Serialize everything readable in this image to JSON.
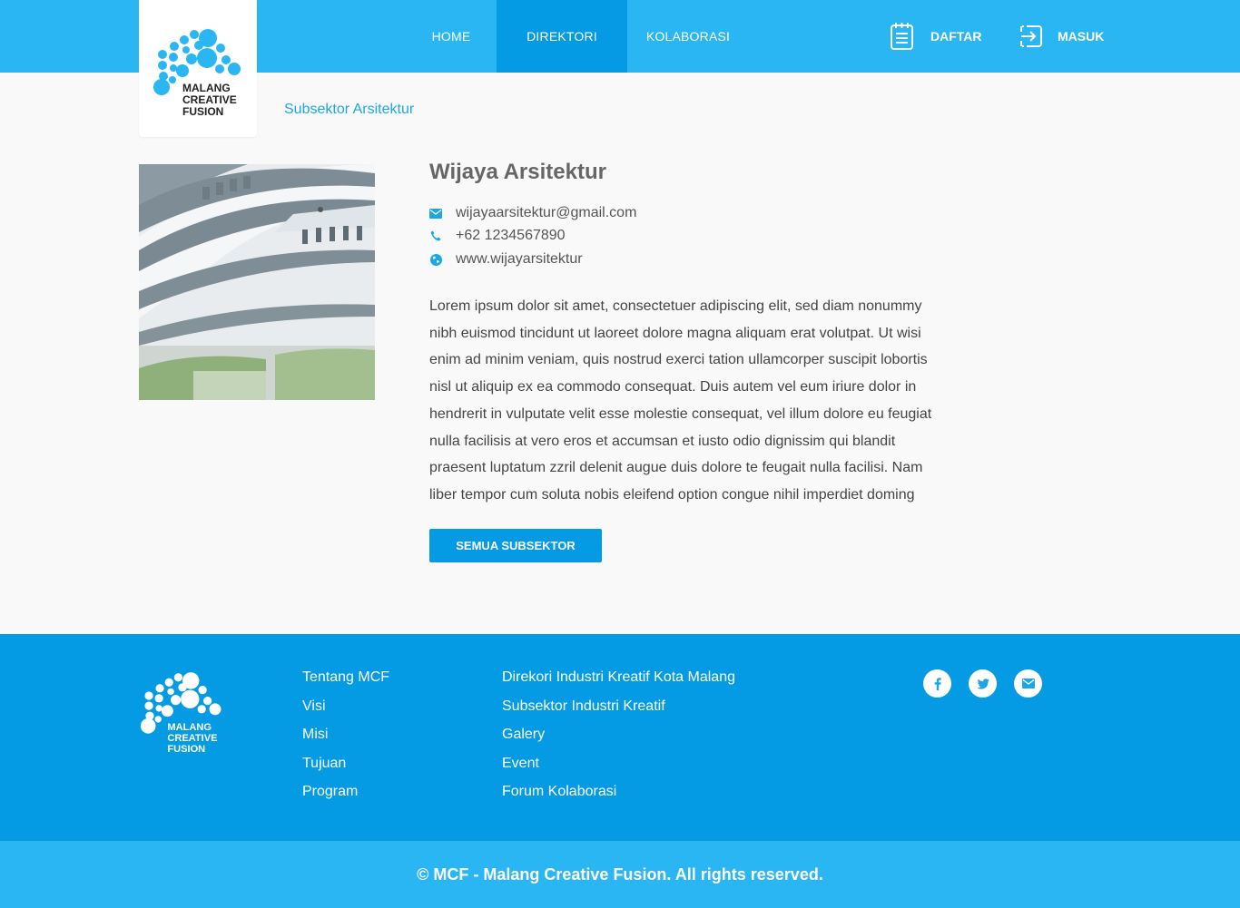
{
  "nav": {
    "home": "HOME",
    "direktori": "DIREKTORI",
    "kolaborasi": "KOLABORASI",
    "daftar": "DAFTAR",
    "masuk": "MASUK",
    "active": "DIREKTORI"
  },
  "logo": {
    "line1": "MALANG",
    "line2": "CREATIVE",
    "line3": "FUSION"
  },
  "breadcrumb": "Subsektor Arsitektur",
  "profile": {
    "name": "Wijaya Arsitektur",
    "email": "wijayaarsitektur@gmail.com",
    "phone": "+62 1234567890",
    "website": "www.wijayarsitektur",
    "description": "Lorem ipsum dolor sit amet, consectetuer adipiscing elit, sed diam nonummy nibh euismod tincidunt ut laoreet dolore magna aliquam erat volutpat. Ut wisi enim ad minim veniam, quis nostrud exerci tation ullamcorper suscipit lobortis nisl ut aliquip ex ea commodo consequat. Duis autem vel eum iriure dolor in hendrerit in vulputate velit esse molestie consequat, vel illum dolore eu feugiat nulla facilisis at vero eros et accumsan et iusto odio dignissim qui blandit praesent luptatum zzril delenit augue duis dolore te feugait nulla facilisi. Nam liber tempor cum soluta nobis eleifend option congue nihil imperdiet doming",
    "button": "SEMUA SUBSEKTOR"
  },
  "footer": {
    "col1": [
      "Tentang MCF",
      "Visi",
      "Misi",
      "Tujuan",
      "Program"
    ],
    "col2": [
      "Direkori Industri Kreatif Kota Malang",
      "Subsektor Industri Kreatif",
      "Galery",
      "Event",
      "Forum Kolaborasi"
    ],
    "social_icons": [
      "facebook-icon",
      "twitter-icon",
      "envelope-icon"
    ],
    "copyright": "© MCF - Malang Creative Fusion. All rights reserved."
  },
  "colors": {
    "header": "#29b6f2",
    "accent": "#049be4",
    "background": "#f9f9f9",
    "text": "#444444"
  }
}
